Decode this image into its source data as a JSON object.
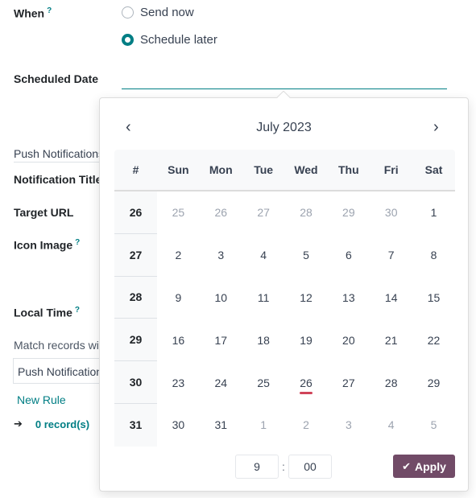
{
  "form": {
    "when_label": "When",
    "help_mark": "?",
    "options": [
      {
        "label": "Send now",
        "checked": false
      },
      {
        "label": "Schedule later",
        "checked": true
      }
    ],
    "scheduled_date_label": "Scheduled Date",
    "scheduled_date_value": "",
    "section_title": "Push Notifications",
    "notification_title_label": "Notification Title",
    "target_url_label": "Target URL",
    "icon_image_label": "Icon Image",
    "local_time_label": "Local Time",
    "match_records_label": "Match records with the following rule",
    "domain_model": "Push Notifications",
    "new_rule_link": "New Rule",
    "records_arrow": "➔",
    "records_count": "0 record(s)"
  },
  "datepicker": {
    "month_title": "July 2023",
    "prev_icon": "‹",
    "next_icon": "›",
    "week_header": "#",
    "weekdays": [
      "Sun",
      "Mon",
      "Tue",
      "Wed",
      "Thu",
      "Fri",
      "Sat"
    ],
    "weeks": [
      {
        "week": "26",
        "days": [
          {
            "d": "25",
            "m": true
          },
          {
            "d": "26",
            "m": true
          },
          {
            "d": "27",
            "m": true
          },
          {
            "d": "28",
            "m": true
          },
          {
            "d": "29",
            "m": true
          },
          {
            "d": "30",
            "m": true
          },
          {
            "d": "1",
            "m": false
          }
        ]
      },
      {
        "week": "27",
        "days": [
          {
            "d": "2"
          },
          {
            "d": "3"
          },
          {
            "d": "4"
          },
          {
            "d": "5"
          },
          {
            "d": "6"
          },
          {
            "d": "7"
          },
          {
            "d": "8"
          }
        ]
      },
      {
        "week": "28",
        "days": [
          {
            "d": "9"
          },
          {
            "d": "10"
          },
          {
            "d": "11"
          },
          {
            "d": "12"
          },
          {
            "d": "13"
          },
          {
            "d": "14"
          },
          {
            "d": "15"
          }
        ]
      },
      {
        "week": "29",
        "days": [
          {
            "d": "16"
          },
          {
            "d": "17"
          },
          {
            "d": "18"
          },
          {
            "d": "19"
          },
          {
            "d": "20"
          },
          {
            "d": "21"
          },
          {
            "d": "22"
          }
        ]
      },
      {
        "week": "30",
        "days": [
          {
            "d": "23"
          },
          {
            "d": "24"
          },
          {
            "d": "25"
          },
          {
            "d": "26",
            "today": true
          },
          {
            "d": "27"
          },
          {
            "d": "28"
          },
          {
            "d": "29"
          }
        ]
      },
      {
        "week": "31",
        "days": [
          {
            "d": "30"
          },
          {
            "d": "31"
          },
          {
            "d": "1",
            "m": true
          },
          {
            "d": "2",
            "m": true
          },
          {
            "d": "3",
            "m": true
          },
          {
            "d": "4",
            "m": true
          },
          {
            "d": "5",
            "m": true
          }
        ]
      }
    ],
    "hour": "9",
    "time_separator": ":",
    "minute": "00",
    "apply_icon": "✔",
    "apply_label": "Apply"
  },
  "colors": {
    "accent": "#017e84",
    "primary_button": "#714b67",
    "today_marker": "#d04459"
  }
}
